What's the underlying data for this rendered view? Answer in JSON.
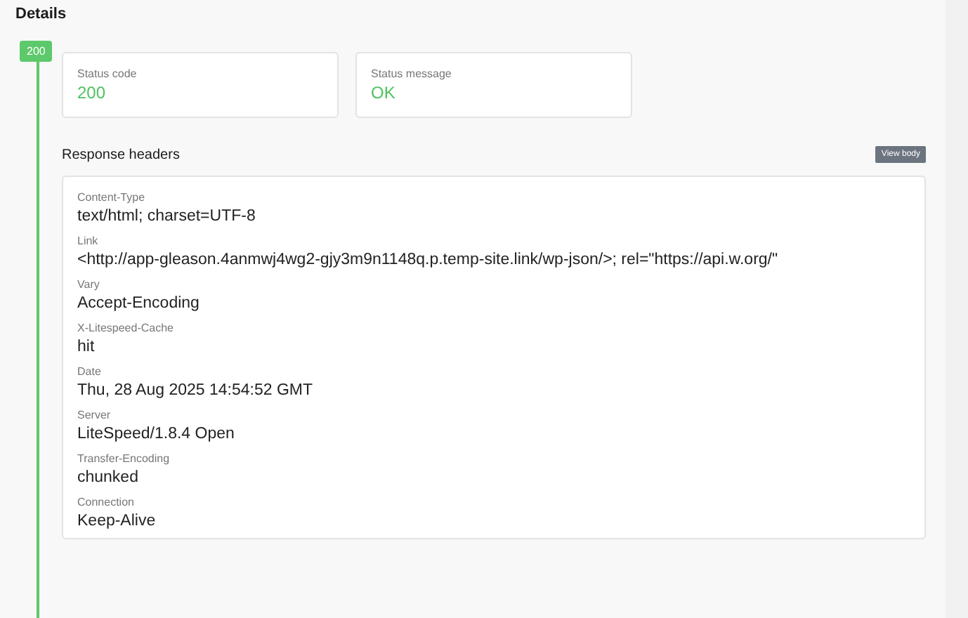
{
  "title": "Details",
  "status_badge": "200",
  "summary": [
    {
      "label": "Status code",
      "value": "200"
    },
    {
      "label": "Status message",
      "value": "OK"
    }
  ],
  "headers_section": {
    "title": "Response headers",
    "button": "View body",
    "headers": [
      {
        "name": "Content-Type",
        "value": "text/html; charset=UTF-8"
      },
      {
        "name": "Link",
        "value": "<http://app-gleason.4anmwj4wg2-gjy3m9n1148q.p.temp-site.link/wp-json/>; rel=\"https://api.w.org/\""
      },
      {
        "name": "Vary",
        "value": "Accept-Encoding"
      },
      {
        "name": "X-Litespeed-Cache",
        "value": "hit"
      },
      {
        "name": "Date",
        "value": "Thu, 28 Aug 2025 14:54:52 GMT"
      },
      {
        "name": "Server",
        "value": "LiteSpeed/1.8.4 Open"
      },
      {
        "name": "Transfer-Encoding",
        "value": "chunked"
      },
      {
        "name": "Connection",
        "value": "Keep-Alive"
      }
    ]
  }
}
